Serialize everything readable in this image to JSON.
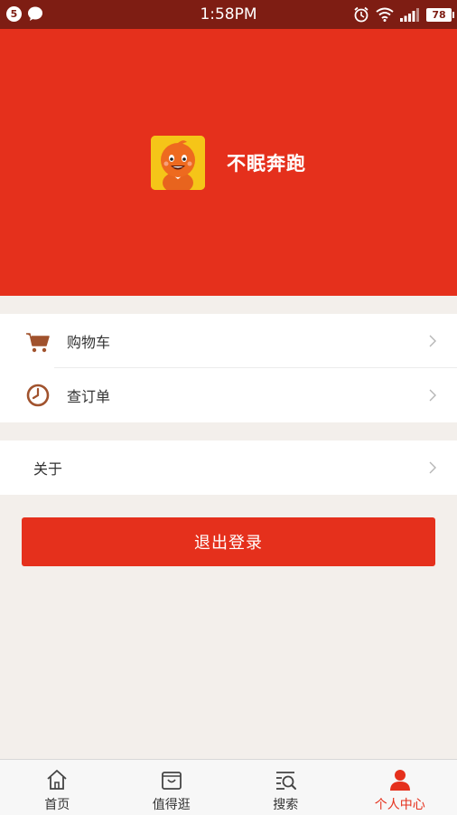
{
  "status_bar": {
    "notification_count": "5",
    "time": "1:58PM",
    "battery": "78",
    "icons": [
      "chat-bubble-icon",
      "alarm-icon",
      "wifi-icon",
      "signal-icon",
      "battery-icon"
    ]
  },
  "profile": {
    "username": "不眠奔跑",
    "avatar_icon": "cartoon-mascot-avatar"
  },
  "menu": {
    "cart_label": "购物车",
    "orders_label": "查订单",
    "about_label": "关于"
  },
  "logout_label": "退出登录",
  "tabs": [
    {
      "label": "首页",
      "icon": "home-icon"
    },
    {
      "label": "值得逛",
      "icon": "shopping-bag-icon"
    },
    {
      "label": "搜索",
      "icon": "search-list-icon"
    },
    {
      "label": "个人中心",
      "icon": "person-icon"
    }
  ],
  "colors": {
    "brand_red": "#e5301c",
    "status_bar": "#7e1d13",
    "icon_brown": "#a0522d",
    "background": "#f3efeb"
  }
}
